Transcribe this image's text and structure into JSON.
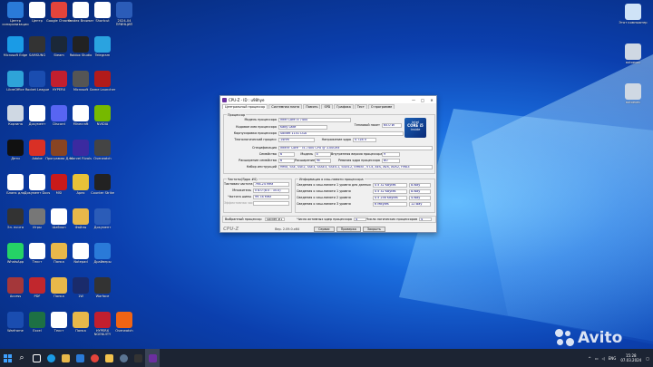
{
  "desktop_icons": [
    {
      "label": "Центр\nсинхронизации",
      "color": "#2a7ad8",
      "icon": "sync-icon"
    },
    {
      "label": "Центр",
      "color": "#fff",
      "icon": "file-icon"
    },
    {
      "label": "Google\nChrome",
      "color": "#e3443b",
      "icon": "chrome-icon"
    },
    {
      "label": "Yandex\nBrowser",
      "color": "#ffffff",
      "icon": "app-icon"
    },
    {
      "label": "Shortcut",
      "color": "#ffffff",
      "icon": "app-icon"
    },
    {
      "label": "2024-04\nПРИНЦИП",
      "color": "#2b5cb8",
      "icon": "word-icon"
    },
    {
      "label": "Microsoft\nEdge",
      "color": "#1a9be6",
      "icon": "edge-icon"
    },
    {
      "label": "SAMSUNG",
      "color": "#333",
      "icon": "app-icon"
    },
    {
      "label": "Steam",
      "color": "#1b2838",
      "icon": "steam-icon"
    },
    {
      "label": "Roblox\nStudio",
      "color": "#222",
      "icon": "roblox-icon"
    },
    {
      "label": "Telegram",
      "color": "#2aa3e0",
      "icon": "telegram-icon"
    },
    {
      "label": "",
      "color": "",
      "icon": ""
    },
    {
      "label": "LibreOffice",
      "color": "#2ea3d8",
      "icon": "app-icon"
    },
    {
      "label": "Rocket\nLeague",
      "color": "#1a4db0",
      "icon": "rocket-league-icon"
    },
    {
      "label": "HYPERX",
      "color": "#c21f2f",
      "icon": "app-icon"
    },
    {
      "label": "Microsoft",
      "color": "#555",
      "icon": "app-icon"
    },
    {
      "label": "Game\nLauncher",
      "color": "#b21b1b",
      "icon": "app-icon"
    },
    {
      "label": "",
      "color": "",
      "icon": ""
    },
    {
      "label": "Корзина",
      "color": "#cfd8e3",
      "icon": "recycle-bin-icon"
    },
    {
      "label": "Документ",
      "color": "#ffffff",
      "icon": "file-icon"
    },
    {
      "label": "Discord",
      "color": "#5865f2",
      "icon": "discord-icon"
    },
    {
      "label": "Minecraft",
      "color": "#fff",
      "icon": "app-icon"
    },
    {
      "label": "NVIDIA",
      "color": "#76b900",
      "icon": "nvidia-icon"
    },
    {
      "label": "",
      "color": "",
      "icon": ""
    },
    {
      "label": "Дети",
      "color": "#111",
      "icon": "app-icon"
    },
    {
      "label": "Adobe",
      "color": "#d93025",
      "icon": "app-icon"
    },
    {
      "label": "Программа\nДля",
      "color": "#884422",
      "icon": "app-icon"
    },
    {
      "label": "Marvel\nRivals",
      "color": "#3b2aa0",
      "icon": "app-icon"
    },
    {
      "label": "Overwatch",
      "color": "#444",
      "icon": "app-icon"
    },
    {
      "label": "",
      "color": "",
      "icon": ""
    },
    {
      "label": "Бланк\nдля",
      "color": "#ffffff",
      "icon": "file-icon"
    },
    {
      "label": "Документ\nDocs",
      "color": "#ffffff",
      "icon": "file-icon"
    },
    {
      "label": "MSI",
      "color": "#c91a1a",
      "icon": "app-icon"
    },
    {
      "label": "Apex",
      "color": "#e8c238",
      "icon": "app-icon"
    },
    {
      "label": "Counter\nStrike",
      "color": "#222",
      "icon": "app-icon"
    },
    {
      "label": "",
      "color": "",
      "icon": ""
    },
    {
      "label": "Эл.\nпочта",
      "color": "#333",
      "icon": "app-icon"
    },
    {
      "label": "Игры",
      "color": "#777",
      "icon": "app-icon"
    },
    {
      "label": "Шаблон",
      "color": "#ffffff",
      "icon": "file-icon"
    },
    {
      "label": "Файлы",
      "color": "#e8b84a",
      "icon": "folder-icon"
    },
    {
      "label": "Документ",
      "color": "#2b5cb8",
      "icon": "word-icon"
    },
    {
      "label": "",
      "color": "",
      "icon": ""
    },
    {
      "label": "WhatsApp",
      "color": "#25d366",
      "icon": "whatsapp-icon"
    },
    {
      "label": "Текст",
      "color": "#ffffff",
      "icon": "file-icon"
    },
    {
      "label": "Папка",
      "color": "#e8b84a",
      "icon": "folder-icon"
    },
    {
      "label": "Notepad",
      "color": "#ffffff",
      "icon": "file-icon"
    },
    {
      "label": "Драйверы",
      "color": "#2a7ad8",
      "icon": "app-icon"
    },
    {
      "label": "",
      "color": "",
      "icon": ""
    },
    {
      "label": "Access",
      "color": "#a4373a",
      "icon": "app-icon"
    },
    {
      "label": "PDF",
      "color": "#c1272d",
      "icon": "pdf-icon"
    },
    {
      "label": "Папка",
      "color": "#e8b84a",
      "icon": "folder-icon"
    },
    {
      "label": "1W",
      "color": "#1a2b6b",
      "icon": "app-icon"
    },
    {
      "label": "Warface",
      "color": "#333",
      "icon": "app-icon"
    },
    {
      "label": "",
      "color": "",
      "icon": ""
    },
    {
      "label": "Warframe",
      "color": "#1a4db0",
      "icon": "app-icon"
    },
    {
      "label": "Excel",
      "color": "#1d7044",
      "icon": "excel-icon"
    },
    {
      "label": "Текст",
      "color": "#ffffff",
      "icon": "file-icon"
    },
    {
      "label": "Папка",
      "color": "#e8b84a",
      "icon": "folder-icon"
    },
    {
      "label": "HYPERX\nNGENUITY",
      "color": "#c21f2f",
      "icon": "app-icon"
    },
    {
      "label": "Overwatch",
      "color": "#f06414",
      "icon": "overwatch-icon"
    }
  ],
  "right_icons": [
    {
      "label": "Этот\nкомпьютер",
      "color": "#cfe3f7",
      "icon": "this-pc-icon"
    },
    {
      "label": "autoexec",
      "color": "#cfd8e3",
      "icon": "file-icon"
    },
    {
      "label": "autoexec",
      "color": "#cfd8e3",
      "icon": "file-icon"
    }
  ],
  "cpuz": {
    "title": "CPU-Z - ID : u98hye",
    "tabs": [
      "Центральный процессор",
      "Системная плата",
      "Память",
      "SPD",
      "Графика",
      "Тест",
      "О программе"
    ],
    "processor_group": "Процессор",
    "model_label": "Модель процессора",
    "model_value": "Intel Core i5 7400",
    "tdp_label": "Тепловой пакет",
    "tdp_value": "65.0 W",
    "codename_label": "Кодовое имя процессора",
    "codename_value": "Kaby Lake",
    "package_label": "Корпусировка процессора",
    "package_value": "Socket 1151 LGA",
    "tech_label": "Технологический процесс",
    "tech_value": "14nm",
    "voltage_label": "Напряжение ядра",
    "voltage_value": "0.728 V",
    "spec_label": "Спецификация",
    "spec_value": "Intel® Core™ i5-7400 CPU @ 3.00GHz",
    "family_label": "Семейство",
    "family_value": "6",
    "model2_label": "Модель",
    "model2_value": "E",
    "stepping_label": "Внутренняя версия процессора",
    "stepping_value": "9",
    "extfamily_label": "Расширение семейства",
    "extfamily_value": "6",
    "extmodel_label": "Расширение модели",
    "extmodel_value": "9E",
    "revision_label": "Ревизия ядра процессора",
    "revision_value": "B0",
    "instructions_label": "Набор инструкций",
    "instructions_value": "MMX, SSE, SSE2, SSE3, SSSE3, SSE4.1, SSE4.2, EM64T, VT-x, AES, AVX, AVX2, FMA3",
    "intel_brand": "intel",
    "intel_core": "CORE i5",
    "intel_inside": "inside",
    "clocks_group": "Частоты(Ядро #0)",
    "core_speed_label": "Тактовая частота",
    "core_speed_value": "798.24 MHz",
    "multiplier_label": "Множитель",
    "multiplier_value": "x 8.0 (8.0 - 35.0)",
    "bus_speed_label": "Частота шины",
    "bus_speed_value": "99.78 MHz",
    "fsb_label": "Эффективная частота",
    "fsb_value": "",
    "cache_group": "Информация о кэш-памяти процессора",
    "cache_rows": [
      {
        "label": "Сведения о кэш-памяти 1 уровня для данных",
        "size": "4 x 32 KBytes",
        "way": "8-way"
      },
      {
        "label": "Сведения о кэш-памяти 1 уровня",
        "size": "4 x 32 KBytes",
        "way": "8-way"
      },
      {
        "label": "Сведения о кэш-памяти 2 уровня",
        "size": "4 x 256 KBytes",
        "way": "4-way"
      },
      {
        "label": "Сведения о кэш-памяти 3 уровня",
        "size": "6 MBytes",
        "way": "12-way"
      }
    ],
    "selected_label": "Выбранный процессор",
    "selected_value": "Socket #1",
    "cores_label": "Число активных ядер процессора",
    "cores_value": "4",
    "threads_label": "Число логических процессоров",
    "threads_value": "4",
    "brand": "CPU-Z",
    "version": "Вер. 2.09.0.x64",
    "btn_tools": "Сервис",
    "btn_validate": "Проверка",
    "btn_close": "Закрыть"
  },
  "taskbar": {
    "lang": "ENG",
    "time": "15:28",
    "date": "07.03.2024"
  },
  "watermark": "Avito"
}
